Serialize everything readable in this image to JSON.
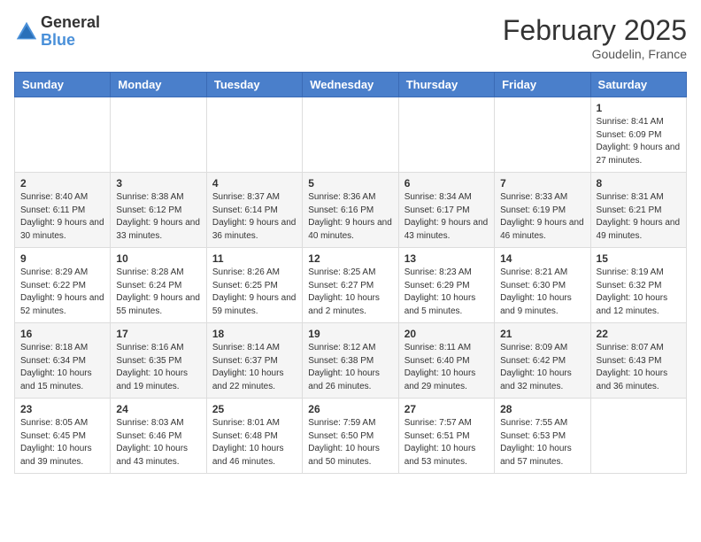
{
  "logo": {
    "general": "General",
    "blue": "Blue"
  },
  "header": {
    "month": "February 2025",
    "location": "Goudelin, France"
  },
  "weekdays": [
    "Sunday",
    "Monday",
    "Tuesday",
    "Wednesday",
    "Thursday",
    "Friday",
    "Saturday"
  ],
  "weeks": [
    [
      {
        "day": "",
        "info": ""
      },
      {
        "day": "",
        "info": ""
      },
      {
        "day": "",
        "info": ""
      },
      {
        "day": "",
        "info": ""
      },
      {
        "day": "",
        "info": ""
      },
      {
        "day": "",
        "info": ""
      },
      {
        "day": "1",
        "info": "Sunrise: 8:41 AM\nSunset: 6:09 PM\nDaylight: 9 hours and 27 minutes."
      }
    ],
    [
      {
        "day": "2",
        "info": "Sunrise: 8:40 AM\nSunset: 6:11 PM\nDaylight: 9 hours and 30 minutes."
      },
      {
        "day": "3",
        "info": "Sunrise: 8:38 AM\nSunset: 6:12 PM\nDaylight: 9 hours and 33 minutes."
      },
      {
        "day": "4",
        "info": "Sunrise: 8:37 AM\nSunset: 6:14 PM\nDaylight: 9 hours and 36 minutes."
      },
      {
        "day": "5",
        "info": "Sunrise: 8:36 AM\nSunset: 6:16 PM\nDaylight: 9 hours and 40 minutes."
      },
      {
        "day": "6",
        "info": "Sunrise: 8:34 AM\nSunset: 6:17 PM\nDaylight: 9 hours and 43 minutes."
      },
      {
        "day": "7",
        "info": "Sunrise: 8:33 AM\nSunset: 6:19 PM\nDaylight: 9 hours and 46 minutes."
      },
      {
        "day": "8",
        "info": "Sunrise: 8:31 AM\nSunset: 6:21 PM\nDaylight: 9 hours and 49 minutes."
      }
    ],
    [
      {
        "day": "9",
        "info": "Sunrise: 8:29 AM\nSunset: 6:22 PM\nDaylight: 9 hours and 52 minutes."
      },
      {
        "day": "10",
        "info": "Sunrise: 8:28 AM\nSunset: 6:24 PM\nDaylight: 9 hours and 55 minutes."
      },
      {
        "day": "11",
        "info": "Sunrise: 8:26 AM\nSunset: 6:25 PM\nDaylight: 9 hours and 59 minutes."
      },
      {
        "day": "12",
        "info": "Sunrise: 8:25 AM\nSunset: 6:27 PM\nDaylight: 10 hours and 2 minutes."
      },
      {
        "day": "13",
        "info": "Sunrise: 8:23 AM\nSunset: 6:29 PM\nDaylight: 10 hours and 5 minutes."
      },
      {
        "day": "14",
        "info": "Sunrise: 8:21 AM\nSunset: 6:30 PM\nDaylight: 10 hours and 9 minutes."
      },
      {
        "day": "15",
        "info": "Sunrise: 8:19 AM\nSunset: 6:32 PM\nDaylight: 10 hours and 12 minutes."
      }
    ],
    [
      {
        "day": "16",
        "info": "Sunrise: 8:18 AM\nSunset: 6:34 PM\nDaylight: 10 hours and 15 minutes."
      },
      {
        "day": "17",
        "info": "Sunrise: 8:16 AM\nSunset: 6:35 PM\nDaylight: 10 hours and 19 minutes."
      },
      {
        "day": "18",
        "info": "Sunrise: 8:14 AM\nSunset: 6:37 PM\nDaylight: 10 hours and 22 minutes."
      },
      {
        "day": "19",
        "info": "Sunrise: 8:12 AM\nSunset: 6:38 PM\nDaylight: 10 hours and 26 minutes."
      },
      {
        "day": "20",
        "info": "Sunrise: 8:11 AM\nSunset: 6:40 PM\nDaylight: 10 hours and 29 minutes."
      },
      {
        "day": "21",
        "info": "Sunrise: 8:09 AM\nSunset: 6:42 PM\nDaylight: 10 hours and 32 minutes."
      },
      {
        "day": "22",
        "info": "Sunrise: 8:07 AM\nSunset: 6:43 PM\nDaylight: 10 hours and 36 minutes."
      }
    ],
    [
      {
        "day": "23",
        "info": "Sunrise: 8:05 AM\nSunset: 6:45 PM\nDaylight: 10 hours and 39 minutes."
      },
      {
        "day": "24",
        "info": "Sunrise: 8:03 AM\nSunset: 6:46 PM\nDaylight: 10 hours and 43 minutes."
      },
      {
        "day": "25",
        "info": "Sunrise: 8:01 AM\nSunset: 6:48 PM\nDaylight: 10 hours and 46 minutes."
      },
      {
        "day": "26",
        "info": "Sunrise: 7:59 AM\nSunset: 6:50 PM\nDaylight: 10 hours and 50 minutes."
      },
      {
        "day": "27",
        "info": "Sunrise: 7:57 AM\nSunset: 6:51 PM\nDaylight: 10 hours and 53 minutes."
      },
      {
        "day": "28",
        "info": "Sunrise: 7:55 AM\nSunset: 6:53 PM\nDaylight: 10 hours and 57 minutes."
      },
      {
        "day": "",
        "info": ""
      }
    ]
  ]
}
